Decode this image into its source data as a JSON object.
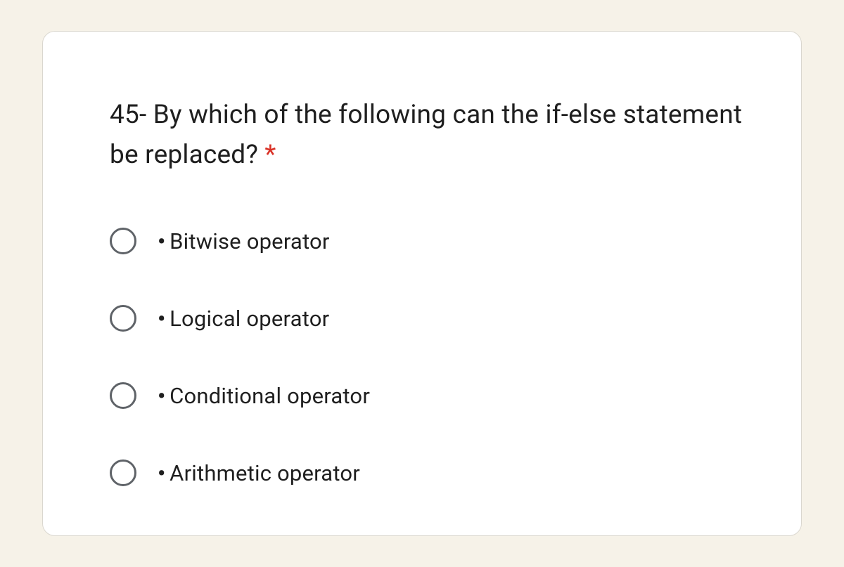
{
  "question": {
    "text": "45- By which of the following can the if-else statement be replaced? ",
    "required_marker": "*"
  },
  "options": [
    {
      "label": "Bitwise operator"
    },
    {
      "label": "Logical operator"
    },
    {
      "label": "Conditional operator"
    },
    {
      "label": "Arithmetic operator"
    }
  ],
  "bullet": "•"
}
